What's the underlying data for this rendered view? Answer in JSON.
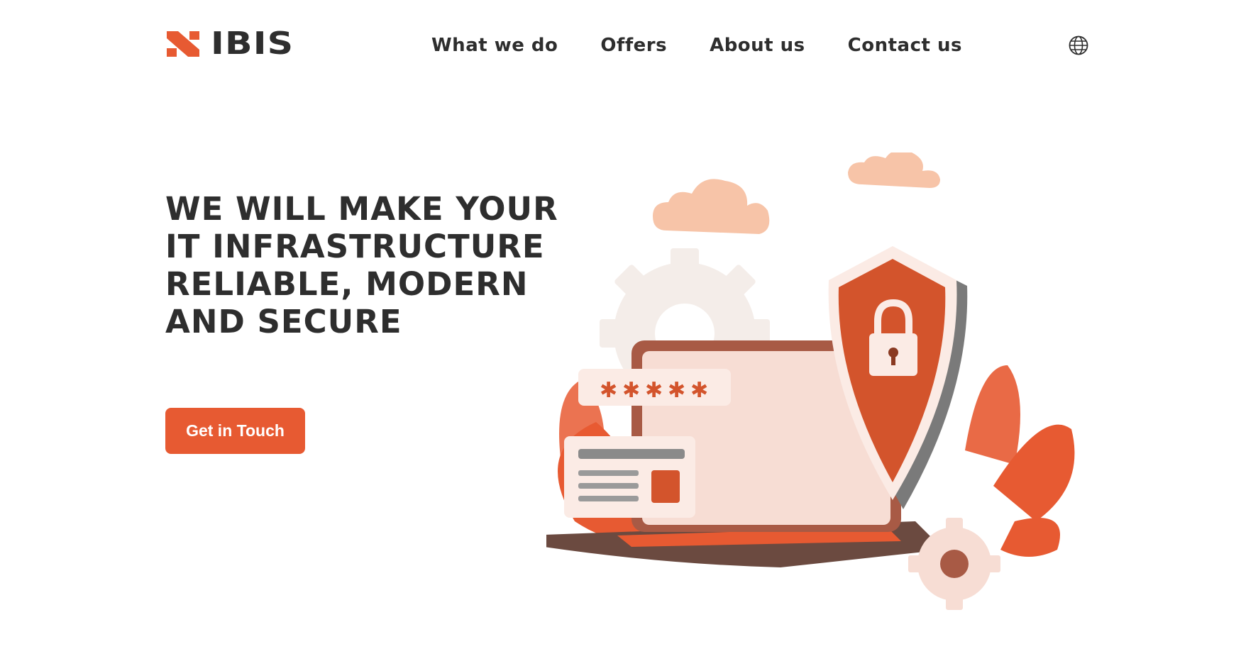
{
  "header": {
    "logo_text": "IBIS",
    "nav": [
      {
        "label": "What we do"
      },
      {
        "label": "Offers"
      },
      {
        "label": "About us"
      },
      {
        "label": "Contact us"
      }
    ],
    "language_icon": "globe-icon"
  },
  "hero": {
    "title": "WE WILL MAKE YOUR\nIT INFRASTRUCTURE\nRELIABLE, MODERN\nAND SECURE",
    "cta_label": "Get in Touch",
    "illustration_icons": [
      "shield-lock-icon",
      "laptop-icon",
      "gear-icon",
      "cloud-icon"
    ]
  },
  "colors": {
    "accent": "#e75a32",
    "text": "#2e2e2e",
    "background": "#ffffff",
    "cloud": "#f7c4a8"
  }
}
